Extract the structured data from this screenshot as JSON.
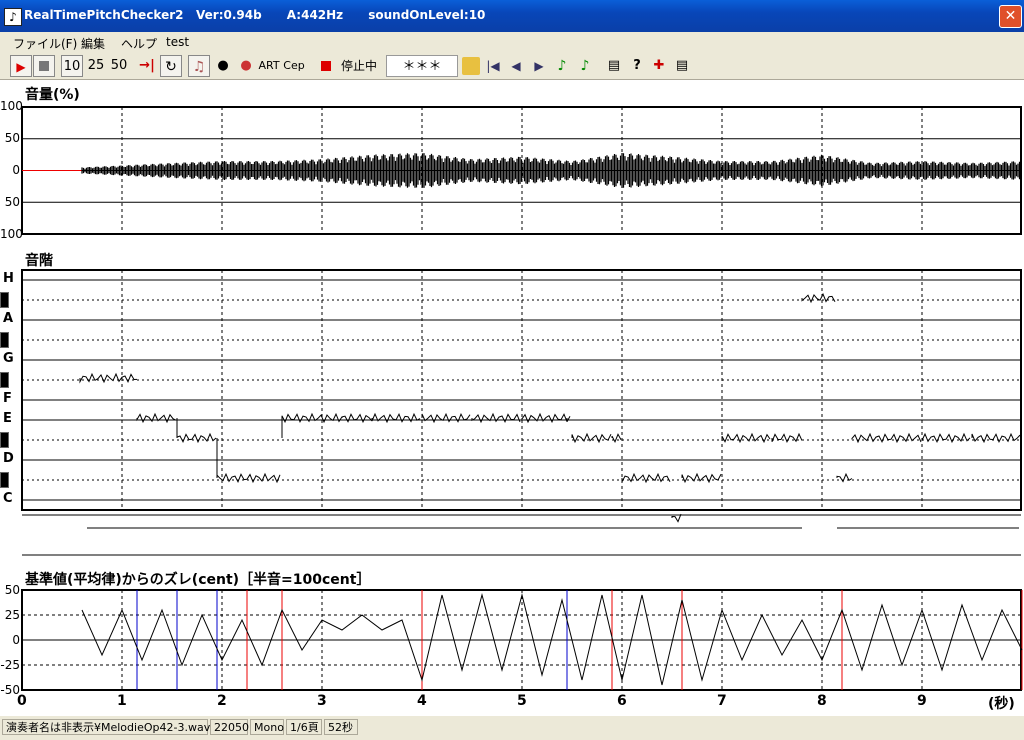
{
  "window": {
    "title": "RealTimePitchChecker2   Ver:0.94b      A:442Hz      soundOnLevel:10",
    "close_label": "✕"
  },
  "menu": [
    "ファイル(F)",
    "編集",
    "ヘルプ",
    "test"
  ],
  "toolbar": {
    "speeds": [
      "10",
      "25",
      "50"
    ],
    "art": "ART",
    "cep": "Cep",
    "status": "停止中",
    "note_display": "＊＊＊"
  },
  "volume_panel": {
    "label": "音量(%)",
    "y_labels": [
      "100",
      "50",
      "0",
      "50",
      "100"
    ]
  },
  "scale_panel": {
    "label": "音階",
    "notes": [
      "H",
      "A",
      "G",
      "F",
      "E",
      "D",
      "C"
    ]
  },
  "deviation_panel": {
    "label": "基準値(平均律)からのズレ(cent)［半音=100cent］",
    "y_labels": [
      "50",
      "25",
      "0",
      "-25",
      "-50"
    ]
  },
  "x_axis": {
    "ticks": [
      "0",
      "1",
      "2",
      "3",
      "4",
      "5",
      "6",
      "7",
      "8",
      "9"
    ],
    "unit": "(秒)"
  },
  "statusbar": {
    "file": "演奏者名は非表示¥MelodieOp42-3.wav",
    "rate": "22050",
    "channels": "Mono",
    "page": "1/6頁",
    "duration": "52秒"
  },
  "chart_data": [
    {
      "type": "line",
      "title": "音量(%)",
      "ylim": [
        -100,
        100
      ],
      "xlim": [
        0,
        10
      ],
      "xlabel": "(秒)",
      "series": [
        {
          "x": [
            0,
            0.6,
            0.6,
            1.0,
            1.5,
            2.0,
            2.5,
            3.0,
            3.5,
            4.0,
            4.5,
            5.0,
            5.5,
            6.0,
            6.5,
            7.0,
            7.5,
            8.0,
            8.5,
            9.0,
            9.5,
            10.0
          ],
          "amplitude": [
            0,
            0,
            5,
            8,
            12,
            15,
            15,
            18,
            25,
            28,
            18,
            22,
            15,
            28,
            22,
            15,
            15,
            25,
            12,
            15,
            12,
            15
          ]
        }
      ]
    },
    {
      "type": "line",
      "title": "音階",
      "xlim": [
        0,
        10
      ],
      "categories": [
        "C",
        "D",
        "E",
        "F",
        "G",
        "A",
        "H"
      ],
      "series": [
        {
          "x": [
            0.58,
            1.0,
            1.15,
            1.55,
            1.55,
            1.95,
            1.95,
            2.6,
            2.6,
            3.2,
            3.5,
            4.0,
            4.5,
            5.0,
            5.45,
            5.5,
            5.9,
            6.0,
            6.5,
            6.6,
            7.0,
            7.5,
            7.8,
            8.15,
            8.3,
            9.0,
            9.5,
            10.0
          ],
          "note": [
            "G",
            "G",
            "F",
            "F",
            "E",
            "E",
            "D",
            "E",
            "F",
            "F",
            "F",
            "F",
            "F",
            "F",
            "F",
            "E",
            "E",
            "D",
            "C",
            "D",
            "E",
            "E",
            "H",
            "D",
            "E",
            "E",
            "E",
            "E"
          ]
        }
      ]
    },
    {
      "type": "line",
      "title": "基準値(平均律)からのズレ(cent)［半音=100cent］",
      "ylim": [
        -50,
        50
      ],
      "xlim": [
        0,
        10
      ],
      "xlabel": "(秒)",
      "series": [
        {
          "x": [
            0.6,
            0.8,
            1.0,
            1.2,
            1.4,
            1.6,
            1.8,
            2.0,
            2.2,
            2.4,
            2.6,
            2.8,
            3.0,
            3.2,
            3.4,
            3.6,
            3.8,
            4.0,
            4.2,
            4.4,
            4.6,
            4.8,
            5.0,
            5.2,
            5.4,
            5.6,
            5.8,
            6.0,
            6.2,
            6.4,
            6.6,
            6.8,
            7.0,
            7.2,
            7.4,
            7.6,
            7.8,
            8.0,
            8.2,
            8.4,
            8.6,
            8.8,
            9.0,
            9.2,
            9.4,
            9.6,
            9.8,
            10.0
          ],
          "cents": [
            30,
            -15,
            30,
            -20,
            30,
            -25,
            25,
            -20,
            20,
            -25,
            30,
            -10,
            20,
            10,
            25,
            10,
            20,
            -40,
            45,
            -30,
            45,
            -30,
            45,
            -35,
            40,
            -40,
            45,
            -40,
            45,
            -45,
            40,
            -40,
            30,
            -20,
            25,
            -15,
            20,
            -20,
            30,
            -30,
            35,
            -25,
            30,
            -30,
            35,
            -20,
            30,
            -10
          ]
        }
      ]
    }
  ]
}
